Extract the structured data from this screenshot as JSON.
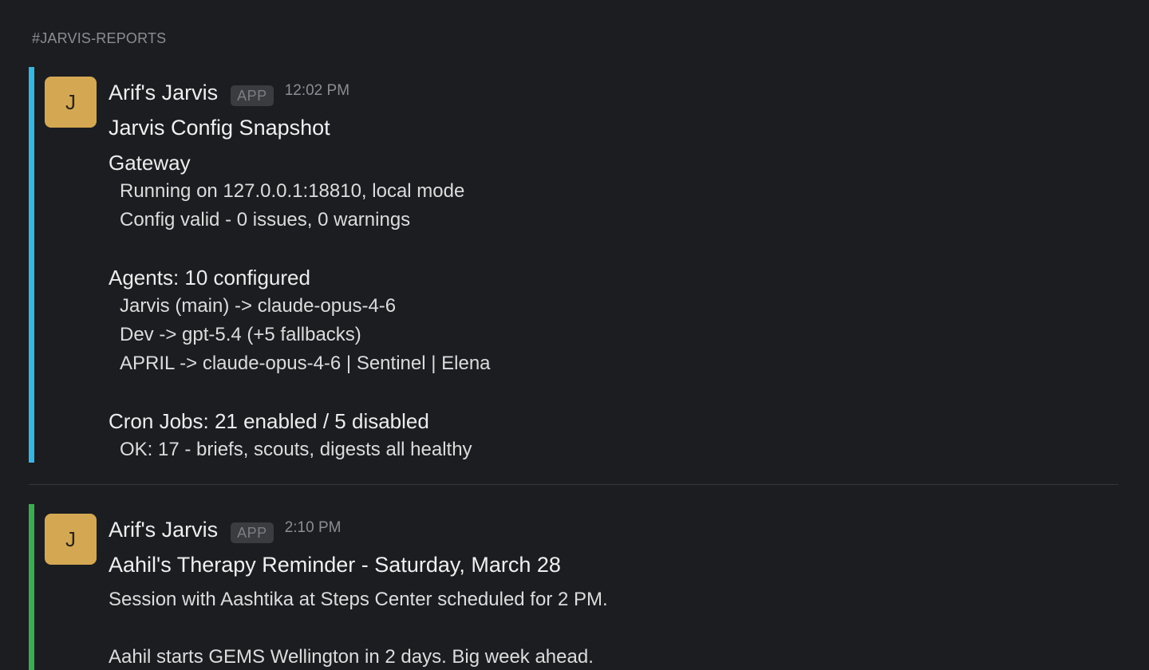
{
  "channel": {
    "name": "#JARVIS-REPORTS"
  },
  "colors": {
    "message1_accent": "#38b6e0",
    "message2_accent": "#3cac50",
    "avatar_bg": "#d4a853"
  },
  "messages": [
    {
      "avatar_letter": "J",
      "sender": "Arif's Jarvis",
      "badge": "APP",
      "time": "12:02 PM",
      "title": "Jarvis Config Snapshot",
      "gateway": {
        "heading": "Gateway",
        "lines": [
          "Running on 127.0.0.1:18810, local mode",
          "Config valid - 0 issues, 0 warnings"
        ]
      },
      "agents": {
        "heading": "Agents: 10 configured",
        "lines": [
          "Jarvis (main) -> claude-opus-4-6",
          "Dev -> gpt-5.4 (+5 fallbacks)",
          "APRIL -> claude-opus-4-6 | Sentinel | Elena"
        ]
      },
      "cron": {
        "heading": "Cron Jobs: 21 enabled / 5 disabled",
        "lines": [
          "OK: 17 - briefs, scouts, digests all healthy"
        ]
      }
    },
    {
      "avatar_letter": "J",
      "sender": "Arif's Jarvis",
      "badge": "APP",
      "time": "2:10 PM",
      "title": "Aahil's Therapy Reminder - Saturday, March 28",
      "paragraphs": [
        "Session with Aashtika at Steps Center scheduled for 2 PM.",
        "Aahil starts GEMS Wellington in 2 days. Big week ahead."
      ]
    }
  ]
}
